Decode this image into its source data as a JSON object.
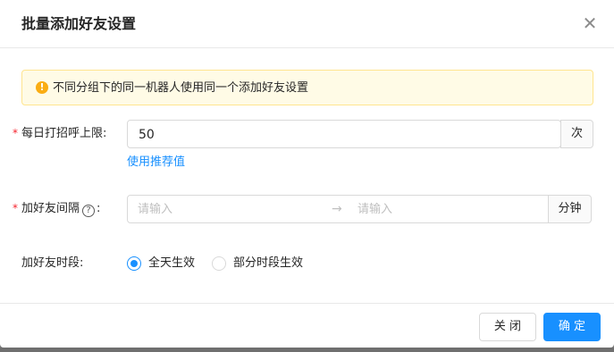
{
  "dialog": {
    "title": "批量添加好友设置",
    "close_icon": "close-icon"
  },
  "alert": {
    "icon": "warning-icon",
    "text": "不同分组下的同一机器人使用同一个添加好友设置"
  },
  "daily_limit": {
    "required_mark": "*",
    "label": "每日打招呼上限:",
    "value": "50",
    "unit": "次",
    "recommend_link": "使用推荐值"
  },
  "interval": {
    "required_mark": "*",
    "label": "加好友间隔",
    "help_icon": "question-circle-icon",
    "help_symbol": "?",
    "colon": ":",
    "start_placeholder": "请输入",
    "separator": "→",
    "end_placeholder": "请输入",
    "unit": "分钟"
  },
  "time_period": {
    "label": "加好友时段:",
    "options": [
      {
        "label": "全天生效",
        "checked": true
      },
      {
        "label": "部分时段生效",
        "checked": false
      }
    ]
  },
  "footer": {
    "close_label": "关 闭",
    "ok_label": "确 定"
  },
  "colors": {
    "primary": "#1890ff",
    "warning": "#faad14",
    "required": "#f5222d"
  }
}
